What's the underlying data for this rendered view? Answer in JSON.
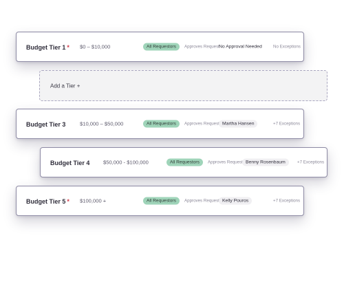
{
  "tiers": [
    {
      "name": "Budget Tier 1",
      "required_marker": "*",
      "range": "$0 – $10,000",
      "requestors": "All Requestors",
      "approves_label": "Approves Request",
      "approver": "No Approval Needed",
      "exceptions": "No Exceptions"
    },
    {
      "name": "Budget Tier 3",
      "required_marker": "",
      "range": "$10,000 – $50,000",
      "requestors": "All Requestors",
      "approves_label": "Approves Request",
      "approver": "Martha Hansen",
      "exceptions": "+7 Exceptions"
    },
    {
      "name": "Budget Tier 4",
      "required_marker": "",
      "range": "$50,000 - $100,000",
      "requestors": "All Requestors",
      "approves_label": "Approves Request",
      "approver": "Benny Rosenbaum",
      "exceptions": "+7 Exceptions"
    },
    {
      "name": "Budget Tier 5",
      "required_marker": "*",
      "range": "$100,000 +",
      "requestors": "All Requestors",
      "approves_label": "Approves Request",
      "approver": "Kelly Pouros",
      "exceptions": "+7 Exceptions"
    }
  ],
  "add_tier": {
    "label": "Add a Tier +"
  },
  "colors": {
    "required_marker": "#d23a4a",
    "requestors_pill": "#9fd4b9",
    "card_border": "#8d8aa4"
  }
}
